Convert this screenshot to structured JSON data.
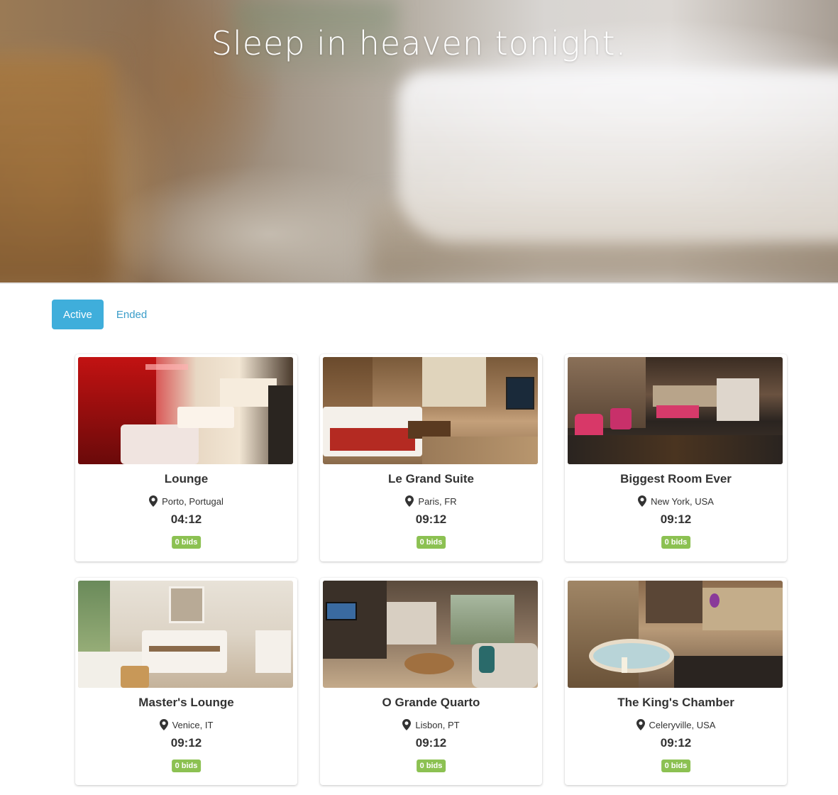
{
  "hero": {
    "title": "Sleep in heaven tonight."
  },
  "tabs": [
    {
      "label": "Active",
      "selected": true
    },
    {
      "label": "Ended",
      "selected": false
    }
  ],
  "colors": {
    "accent": "#3faedb",
    "link": "#3a9dc9",
    "badge": "#8cc152",
    "text": "#333333"
  },
  "listings": [
    {
      "name": "Lounge",
      "location": "Porto, Portugal",
      "time": "04:12",
      "bids": "0 bids"
    },
    {
      "name": "Le Grand Suite",
      "location": "Paris, FR",
      "time": "09:12",
      "bids": "0 bids"
    },
    {
      "name": "Biggest Room Ever",
      "location": "New York, USA",
      "time": "09:12",
      "bids": "0 bids"
    },
    {
      "name": "Master's Lounge",
      "location": "Venice, IT",
      "time": "09:12",
      "bids": "0 bids"
    },
    {
      "name": "O Grande Quarto",
      "location": "Lisbon, PT",
      "time": "09:12",
      "bids": "0 bids"
    },
    {
      "name": "The King's Chamber",
      "location": "Celeryville, USA",
      "time": "09:12",
      "bids": "0 bids"
    }
  ],
  "icons": {
    "location": "map-pin-icon"
  }
}
